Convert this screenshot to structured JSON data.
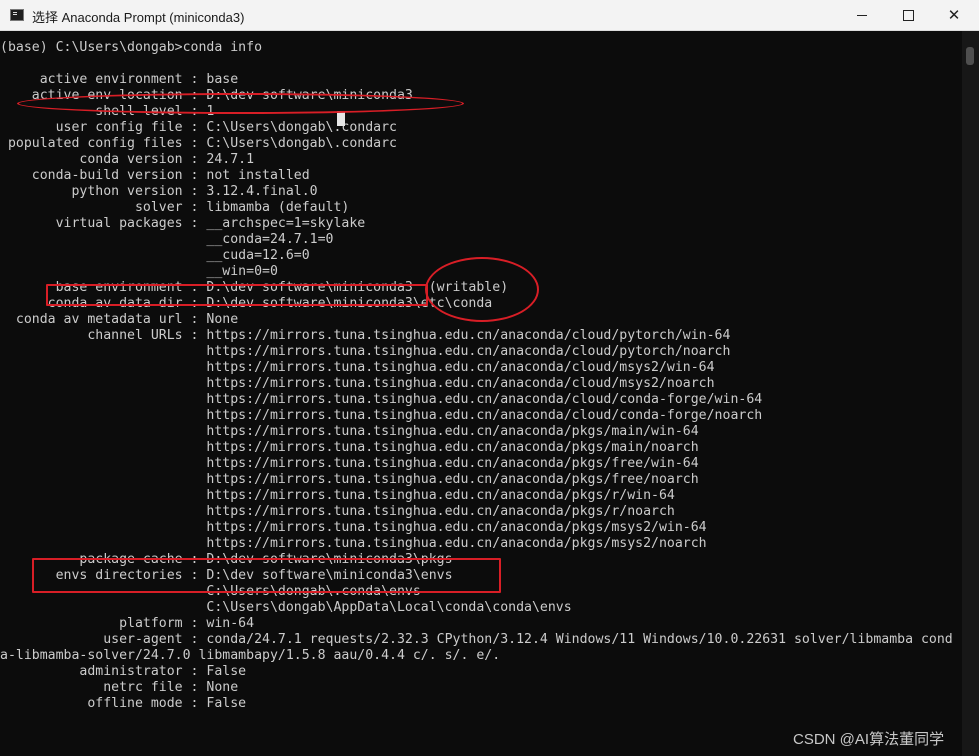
{
  "window": {
    "title": "选择 Anaconda Prompt (miniconda3)",
    "icon": "terminal-icon",
    "controls": {
      "minimize": "minimize-icon",
      "maximize": "maximize-icon",
      "close": "close-icon",
      "close_glyph": "✕"
    }
  },
  "console": {
    "lines": [
      "",
      "(base) C:\\Users\\dongab>conda info",
      "",
      "     active environment : base",
      "    active env location : D:\\dev software\\miniconda3",
      "            shell level : 1",
      "       user config file : C:\\Users\\dongab\\.condarc",
      " populated config files : C:\\Users\\dongab\\.condarc",
      "          conda version : 24.7.1",
      "    conda-build version : not installed",
      "         python version : 3.12.4.final.0",
      "                 solver : libmamba (default)",
      "       virtual packages : __archspec=1=skylake",
      "                          __conda=24.7.1=0",
      "                          __cuda=12.6=0",
      "                          __win=0=0",
      "       base environment : D:\\dev software\\miniconda3  (writable)",
      "      conda av data dir : D:\\dev software\\miniconda3\\etc\\conda",
      "  conda av metadata url : None",
      "           channel URLs : https://mirrors.tuna.tsinghua.edu.cn/anaconda/cloud/pytorch/win-64",
      "                          https://mirrors.tuna.tsinghua.edu.cn/anaconda/cloud/pytorch/noarch",
      "                          https://mirrors.tuna.tsinghua.edu.cn/anaconda/cloud/msys2/win-64",
      "                          https://mirrors.tuna.tsinghua.edu.cn/anaconda/cloud/msys2/noarch",
      "                          https://mirrors.tuna.tsinghua.edu.cn/anaconda/cloud/conda-forge/win-64",
      "                          https://mirrors.tuna.tsinghua.edu.cn/anaconda/cloud/conda-forge/noarch",
      "                          https://mirrors.tuna.tsinghua.edu.cn/anaconda/pkgs/main/win-64",
      "                          https://mirrors.tuna.tsinghua.edu.cn/anaconda/pkgs/main/noarch",
      "                          https://mirrors.tuna.tsinghua.edu.cn/anaconda/pkgs/free/win-64",
      "                          https://mirrors.tuna.tsinghua.edu.cn/anaconda/pkgs/free/noarch",
      "                          https://mirrors.tuna.tsinghua.edu.cn/anaconda/pkgs/r/win-64",
      "                          https://mirrors.tuna.tsinghua.edu.cn/anaconda/pkgs/r/noarch",
      "                          https://mirrors.tuna.tsinghua.edu.cn/anaconda/pkgs/msys2/win-64",
      "                          https://mirrors.tuna.tsinghua.edu.cn/anaconda/pkgs/msys2/noarch",
      "          package cache : D:\\dev software\\miniconda3\\pkgs",
      "       envs directories : D:\\dev software\\miniconda3\\envs",
      "                          C:\\Users\\dongab\\.conda\\envs",
      "                          C:\\Users\\dongab\\AppData\\Local\\conda\\conda\\envs",
      "               platform : win-64",
      "             user-agent : conda/24.7.1 requests/2.32.3 CPython/3.12.4 Windows/11 Windows/10.0.22631 solver/libmamba cond",
      "a-libmamba-solver/24.7.0 libmambapy/1.5.8 aau/0.4.4 c/. s/. e/.",
      "          administrator : False",
      "             netrc file : None",
      "           offline mode : False"
    ]
  },
  "watermark": "CSDN @AI算法董同学"
}
